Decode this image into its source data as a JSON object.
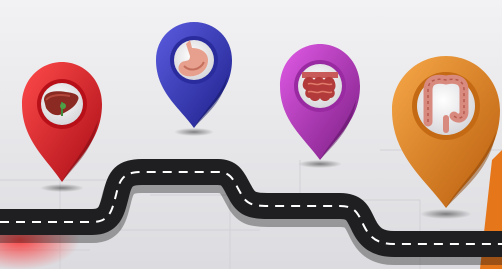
{
  "scene": {
    "description_label": "",
    "background_color": "#e9e9ec",
    "road_color": "#1f1f22",
    "road_marking_color": "#ffffff"
  },
  "pins": [
    {
      "id": "liver",
      "organ_icon": "liver-icon",
      "color": "#e0202a",
      "dark": "#8f0d15"
    },
    {
      "id": "stomach",
      "organ_icon": "stomach-icon",
      "color": "#3d3fc4",
      "dark": "#1c1f7a"
    },
    {
      "id": "small-intestine",
      "organ_icon": "small-intestine-icon",
      "color": "#c23cc8",
      "dark": "#6b1a72"
    },
    {
      "id": "large-intestine",
      "organ_icon": "large-intestine-icon",
      "color": "#ea8a1f",
      "dark": "#9a4f0a"
    }
  ]
}
